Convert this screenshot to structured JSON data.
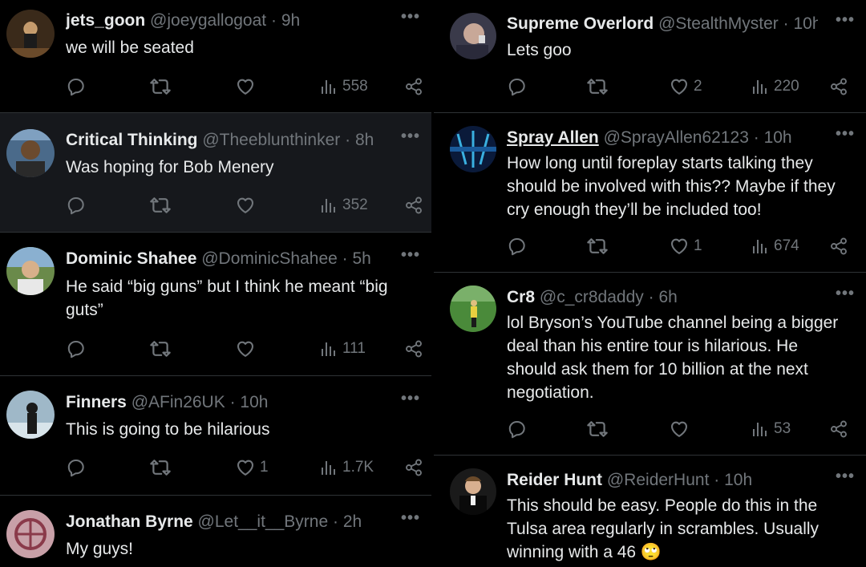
{
  "left": [
    {
      "name": "jets_goon",
      "handle": "@joeygallogoat",
      "time": "9h",
      "text": "we will be seated",
      "replies": "",
      "retweets": "",
      "likes": "",
      "views": "558"
    },
    {
      "name": "Critical Thinking",
      "handle": "@Theeblunthinker",
      "time": "8h",
      "text": "Was hoping for Bob Menery",
      "replies": "",
      "retweets": "",
      "likes": "",
      "views": "352"
    },
    {
      "name": "Dominic Shahee",
      "handle": "@DominicShahee",
      "time": "5h",
      "text": "He said “big guns” but I think he meant “big guts”",
      "replies": "",
      "retweets": "",
      "likes": "",
      "views": "111"
    },
    {
      "name": "Finners",
      "handle": "@AFin26UK",
      "time": "10h",
      "text": "This is going to be hilarious",
      "replies": "",
      "retweets": "",
      "likes": "1",
      "views": "1.7K"
    },
    {
      "name": "Jonathan Byrne",
      "handle": "@Let__it__Byrne",
      "time": "2h",
      "text": "My guys!",
      "replies": "",
      "retweets": "",
      "likes": "",
      "views": ""
    }
  ],
  "right": [
    {
      "name": "Supreme Overlord",
      "handle": "@StealthMyster",
      "time": "10h",
      "text": "Lets goo",
      "replies": "",
      "retweets": "",
      "likes": "2",
      "views": "220"
    },
    {
      "name": "Spray Allen",
      "handle": "@SprayAllen62123",
      "time": "10h",
      "text": "How long until foreplay starts talking they should be involved with this?? Maybe if they cry enough they’ll be included too!",
      "replies": "",
      "retweets": "",
      "likes": "1",
      "views": "674"
    },
    {
      "name": "Cr8",
      "handle": "@c_cr8daddy",
      "time": "6h",
      "text": "lol Bryson’s YouTube channel being a bigger deal than his entire tour is hilarious. He should ask them for 10 billion at the next negotiation.",
      "replies": "",
      "retweets": "",
      "likes": "",
      "views": "53"
    },
    {
      "name": "Reider Hunt",
      "handle": "@ReiderHunt",
      "time": "10h",
      "text": "This should be easy. People do this in the Tulsa area regularly in scrambles.  Usually winning with a 46 🙄",
      "replies": "",
      "retweets": "",
      "likes": "",
      "views": ""
    }
  ],
  "ui": {
    "dot": "·",
    "more": "•••"
  },
  "colors": {
    "background": "#000000",
    "highlight": "#16181c",
    "text": "#e7e9ea",
    "muted": "#71767b",
    "divider": "#2f3336"
  },
  "icons": {
    "reply": "reply-icon",
    "retweet": "retweet-icon",
    "like": "heart-icon",
    "views": "views-icon",
    "share": "share-icon",
    "more": "more-icon"
  }
}
